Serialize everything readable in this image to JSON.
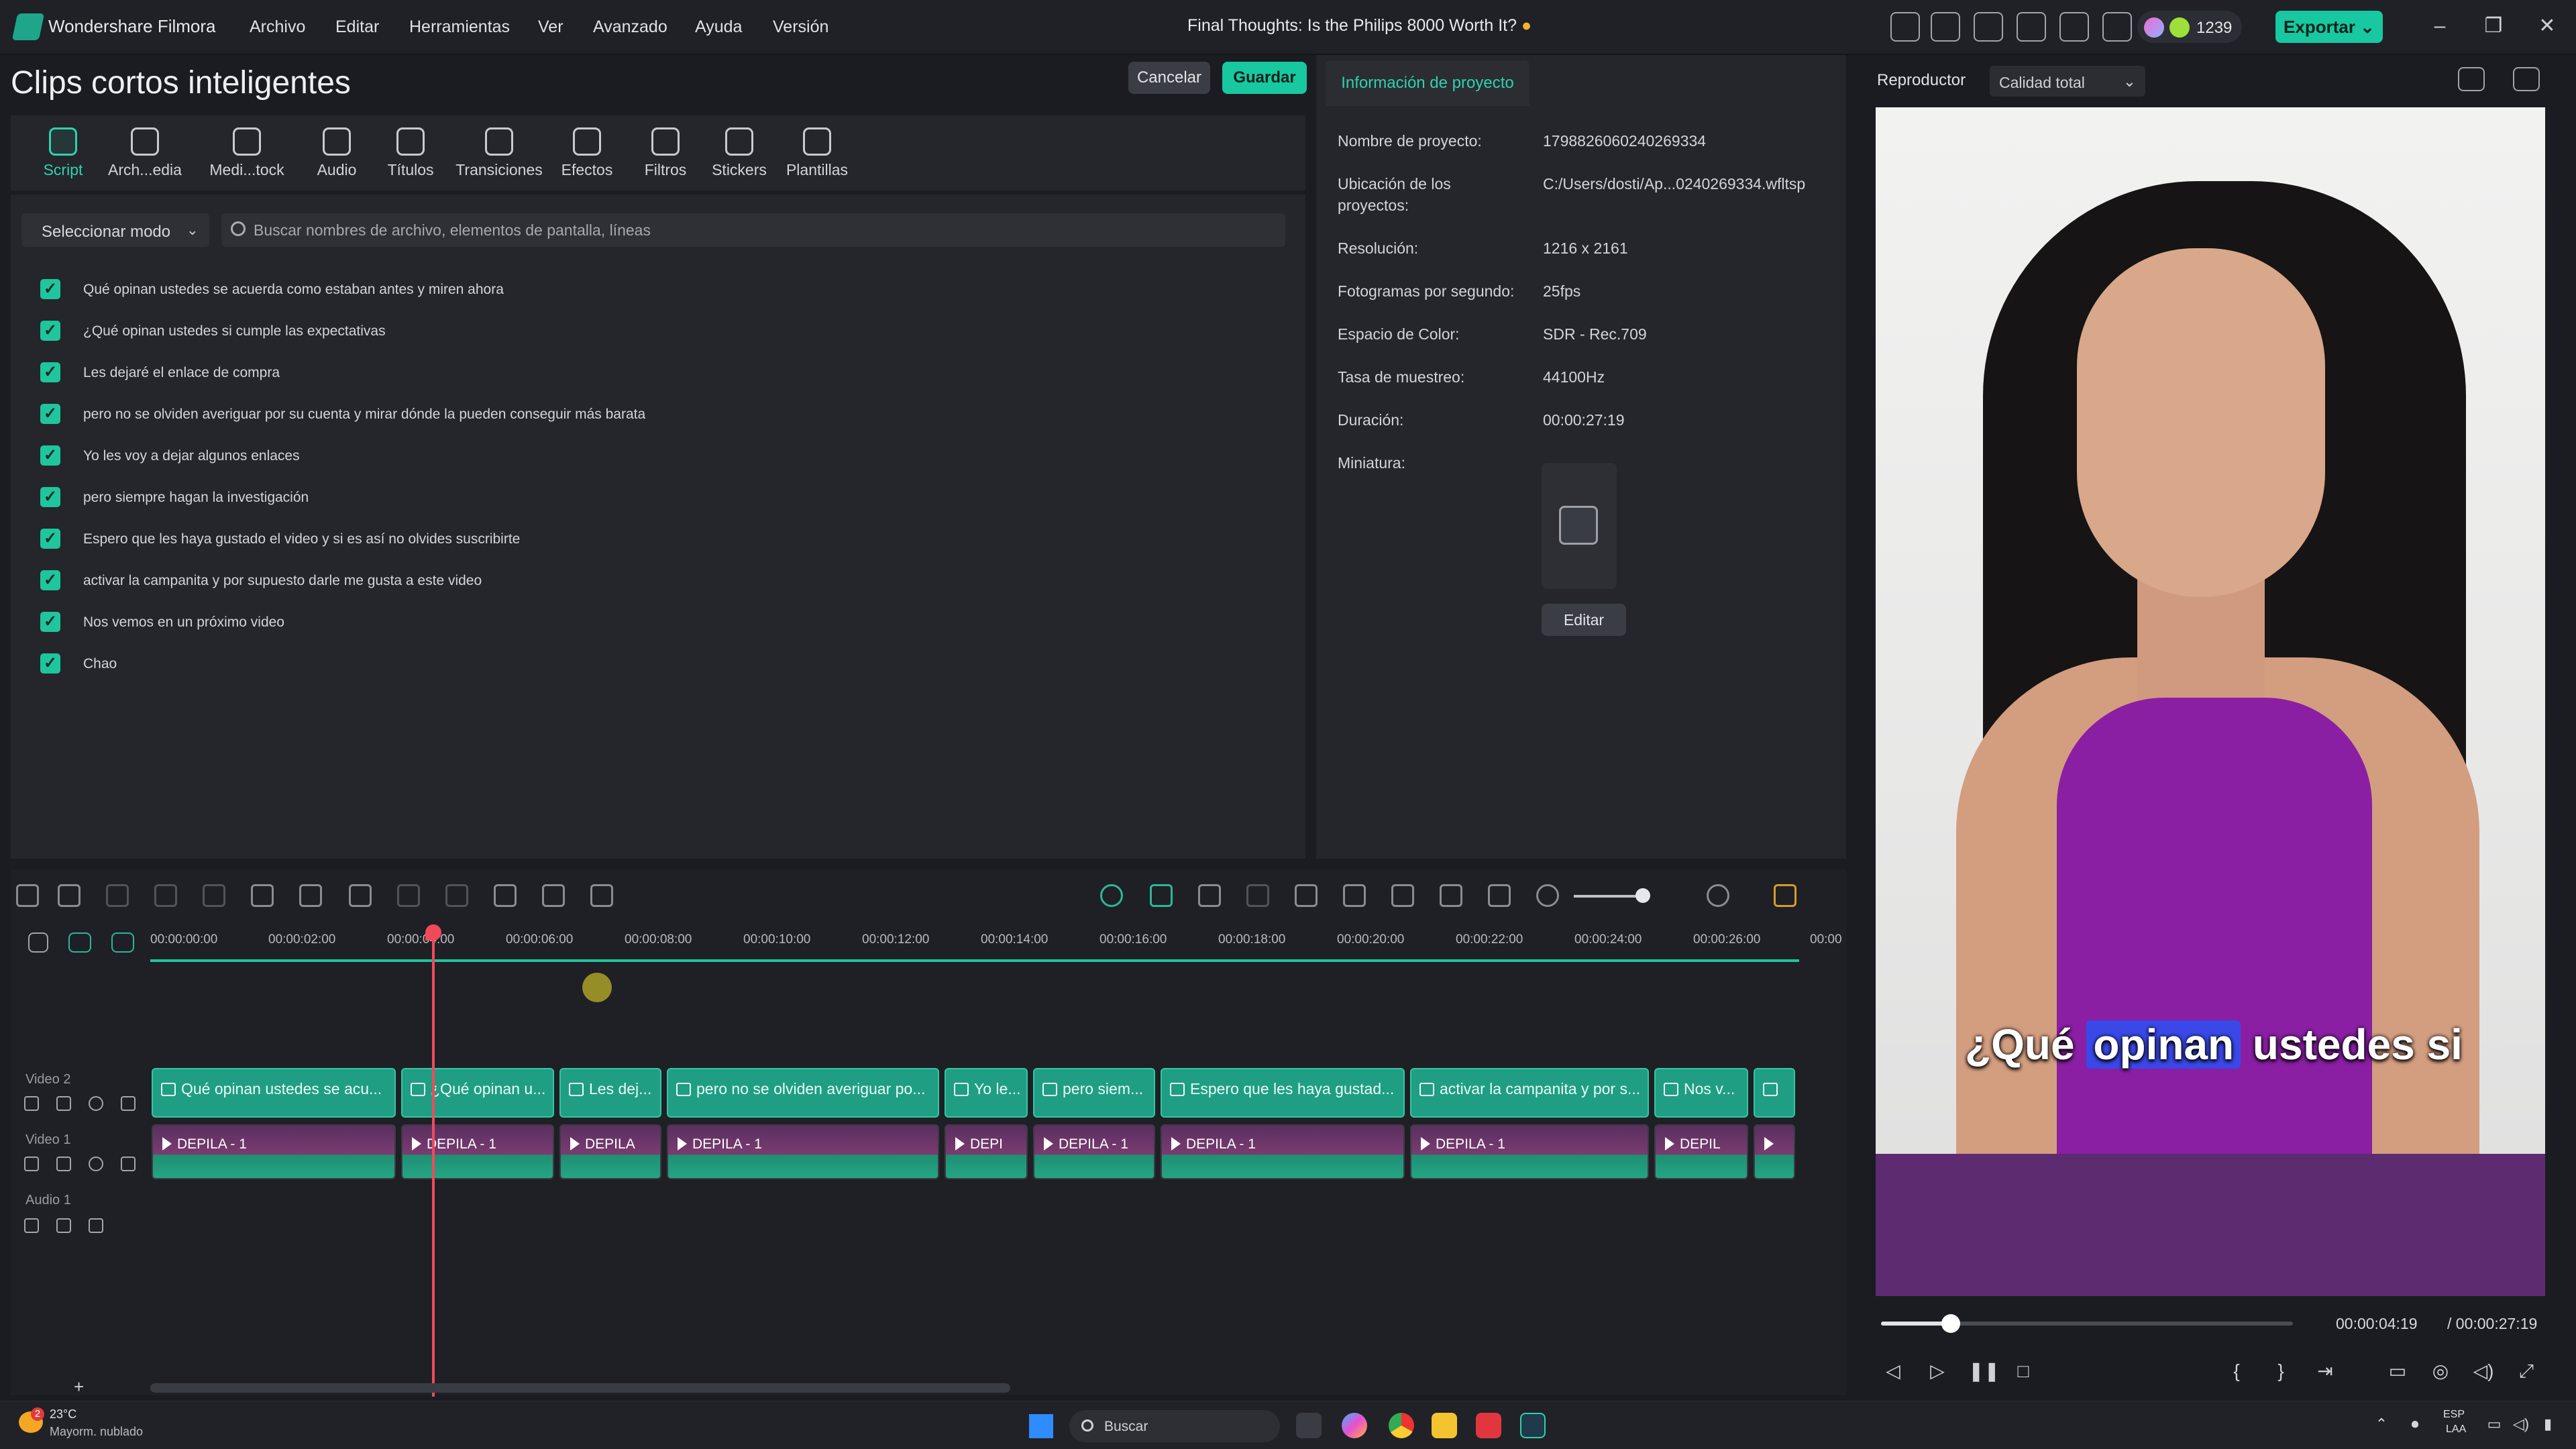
{
  "app": {
    "name": "Wondershare Filmora",
    "project_title": "Final Thoughts: Is the Philips 8000 Worth It?",
    "menu": [
      "Archivo",
      "Editar",
      "Herramientas",
      "Ver",
      "Avanzado",
      "Ayuda",
      "Versión"
    ],
    "credits": "1239",
    "export_label": "Exportar"
  },
  "panel": {
    "title": "Clips cortos inteligentes",
    "cancel_label": "Cancelar",
    "save_label": "Guardar",
    "tabs": [
      {
        "label": "Script",
        "icon": "script-icon",
        "active": true
      },
      {
        "label": "Arch...edia",
        "icon": "media-icon"
      },
      {
        "label": "Medi...tock",
        "icon": "stock-media-icon"
      },
      {
        "label": "Audio",
        "icon": "music-note-icon"
      },
      {
        "label": "Títulos",
        "icon": "text-t-icon"
      },
      {
        "label": "Transiciones",
        "icon": "transition-icon"
      },
      {
        "label": "Efectos",
        "icon": "effects-icon"
      },
      {
        "label": "Filtros",
        "icon": "filter-icon"
      },
      {
        "label": "Stickers",
        "icon": "sticker-icon"
      },
      {
        "label": "Plantillas",
        "icon": "template-icon"
      }
    ],
    "mode_select": "Seleccionar modo",
    "search_placeholder": "Buscar nombres de archivo, elementos de pantalla, líneas",
    "script_lines": [
      "Qué opinan ustedes se acuerda como estaban antes y miren ahora",
      "¿Qué opinan ustedes si cumple las expectativas",
      "Les dejaré el enlace de compra",
      "pero no se olviden averiguar por su cuenta y mirar dónde la pueden conseguir más barata",
      "Yo les voy a dejar algunos enlaces",
      "pero siempre hagan la investigación",
      "Espero que les haya gustado el video y si es así no olvides suscribirte",
      "activar la campanita y por supuesto darle me gusta a este video",
      "Nos vemos en un próximo video",
      "Chao"
    ]
  },
  "info": {
    "tab": "Información de proyecto",
    "rows": [
      {
        "label": "Nombre de proyecto:",
        "value": "1798826060240269334"
      },
      {
        "label": "Ubicación de los proyectos:",
        "value": "C:/Users/dosti/Ap...0240269334.wfltsp"
      },
      {
        "label": "Resolución:",
        "value": "1216 x 2161"
      },
      {
        "label": "Fotogramas por segundo:",
        "value": "25fps"
      },
      {
        "label": "Espacio de Color:",
        "value": "SDR - Rec.709"
      },
      {
        "label": "Tasa de muestreo:",
        "value": "44100Hz"
      },
      {
        "label": "Duración:",
        "value": "00:00:27:19"
      },
      {
        "label": "Miniatura:",
        "value": ""
      }
    ],
    "edit_label": "Editar"
  },
  "player": {
    "label": "Reproductor",
    "quality": "Calidad total",
    "caption_pre": "¿Qué",
    "caption_hl": "opinan",
    "caption_post": "ustedes si",
    "current_time": "00:00:04:19",
    "duration": "/ 00:00:27:19",
    "progress": 0.17
  },
  "timeline": {
    "ticks": [
      "00:00:00:00",
      "00:00:02:00",
      "00:00:04:00",
      "00:00:06:00",
      "00:00:08:00",
      "00:00:10:00",
      "00:00:12:00",
      "00:00:14:00",
      "00:00:16:00",
      "00:00:18:00",
      "00:00:20:00",
      "00:00:22:00",
      "00:00:24:00",
      "00:00:26:00",
      "00:00"
    ],
    "tracks": [
      "Video 2",
      "Video 1",
      "Audio 1"
    ],
    "title_clips": [
      "Qué opinan ustedes se acu...",
      "¿Qué opinan u...",
      "Les dej...",
      "pero no se olviden averiguar po...",
      "Yo le...",
      "pero siem...",
      "Espero que les haya gustad...",
      "activar la campanita y por s...",
      "Nos v...",
      ""
    ],
    "video_clips": [
      "DEPILA - 1",
      "DEPILA - 1",
      "DEPILA",
      "DEPILA - 1",
      "DEPI",
      "DEPILA - 1",
      "DEPILA - 1",
      "DEPILA - 1",
      "DEPIL",
      ""
    ]
  },
  "taskbar": {
    "weather_temp": "23°C",
    "weather_desc": "Mayorm. nublado",
    "weather_badge": "2",
    "search": "Buscar",
    "lang1": "ESP",
    "lang2": "LAA"
  }
}
